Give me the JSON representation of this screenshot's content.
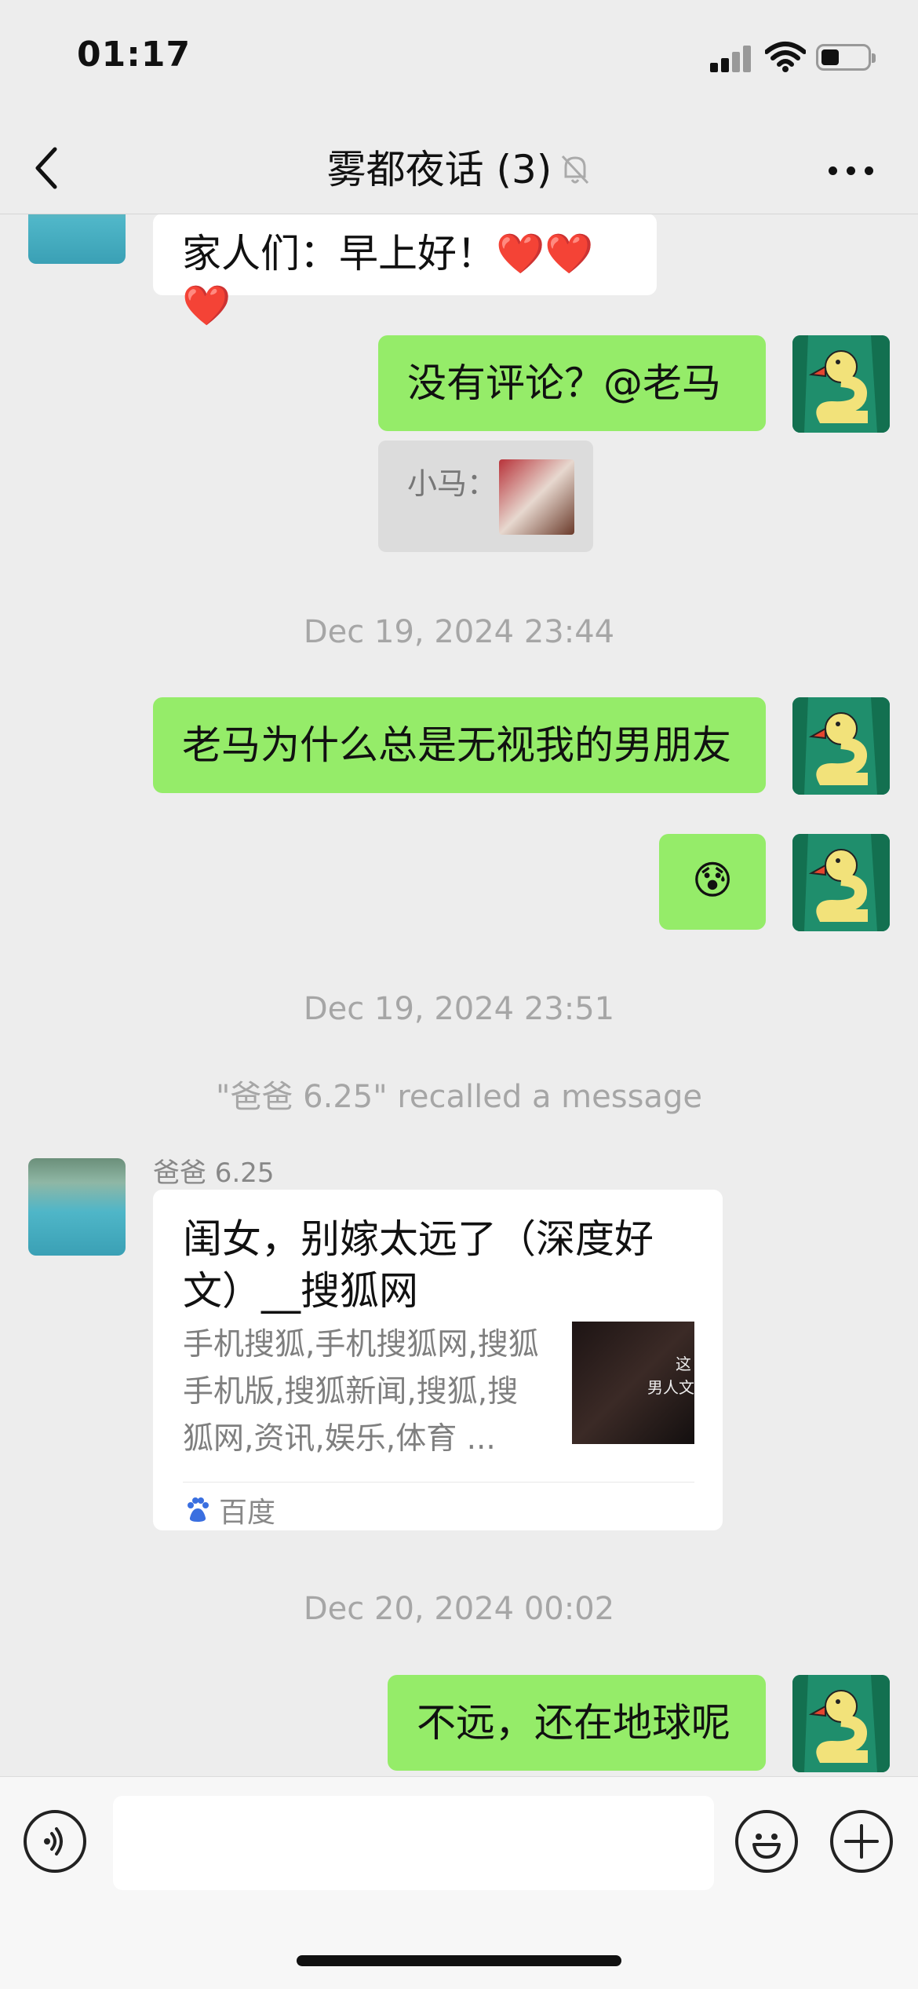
{
  "status_bar": {
    "time": "01:17"
  },
  "nav": {
    "title": "雾都夜话 (3)"
  },
  "messages": {
    "m1_text": "家人们：早上好！❤️❤️❤️",
    "m2_text": "没有评论？@老马",
    "m2_quote_label": "小马：",
    "ts1": "Dec 19, 2024 23:44",
    "m3_text": "老马为什么总是无视我的男朋友",
    "m4_emoji": "😰",
    "ts2": "Dec 19, 2024 23:51",
    "recall_notice": "\"爸爸 6.25\" recalled a message",
    "m5_sender": "爸爸 6.25",
    "ts3": "Dec 20, 2024 00:02",
    "m6_text": "不远，还在地球呢"
  },
  "link_card": {
    "title": "闺女，别嫁太远了（深度好文）__搜狐网",
    "description": "手机搜狐,手机搜狐网,搜狐手机版,搜狐新闻,搜狐,搜狐网,资讯,娱乐,体育 ...",
    "source": "百度",
    "thumb_text_1": "这",
    "thumb_text_2": "男人文"
  },
  "colors": {
    "background": "#ededed",
    "bubble_green": "#95ec69",
    "bubble_white": "#ffffff",
    "timestamp_gray": "#a6a6a6"
  },
  "icons": [
    "back-arrow-icon",
    "mute-bell-icon",
    "more-dots-icon",
    "voice-icon",
    "emoji-icon",
    "plus-icon",
    "baidu-paw-icon",
    "signal-icon",
    "wifi-icon",
    "battery-icon"
  ]
}
